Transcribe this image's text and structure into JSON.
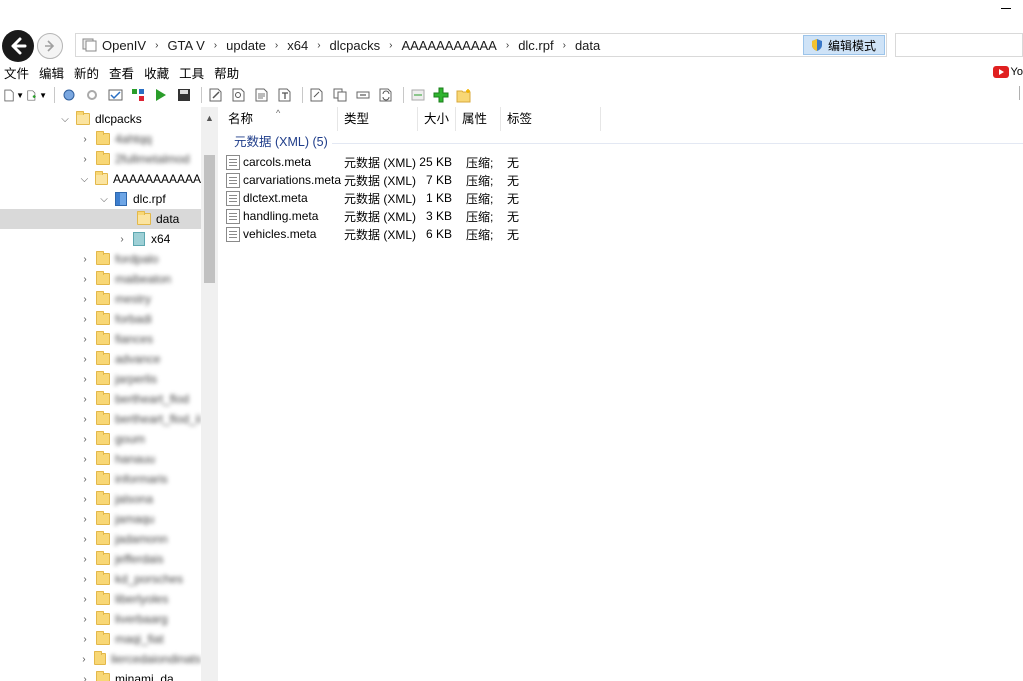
{
  "breadcrumb": [
    "OpenIV",
    "GTA V",
    "update",
    "x64",
    "dlcpacks",
    "AAAAAAAAAAA",
    "dlc.rpf",
    "data"
  ],
  "edit_mode_label": "编辑模式",
  "menu": [
    "文件",
    "编辑",
    "新的",
    "查看",
    "收藏",
    "工具",
    "帮助"
  ],
  "youtube_label": "Yo",
  "columns": {
    "name": "名称",
    "type": "类型",
    "size": "大小",
    "attr": "属性",
    "tag": "标签"
  },
  "group_header": "元数据 (XML) (5)",
  "files": [
    {
      "name": "carcols.meta",
      "type": "元数据 (XML)",
      "size": "25 KB",
      "attr": "压缩;",
      "tag": "无"
    },
    {
      "name": "carvariations.meta",
      "type": "元数据 (XML)",
      "size": "7 KB",
      "attr": "压缩;",
      "tag": "无"
    },
    {
      "name": "dlctext.meta",
      "type": "元数据 (XML)",
      "size": "1 KB",
      "attr": "压缩;",
      "tag": "无"
    },
    {
      "name": "handling.meta",
      "type": "元数据 (XML)",
      "size": "3 KB",
      "attr": "压缩;",
      "tag": "无"
    },
    {
      "name": "vehicles.meta",
      "type": "元数据 (XML)",
      "size": "6 KB",
      "attr": "压缩;",
      "tag": "无"
    }
  ],
  "tree": {
    "root": "dlcpacks",
    "blurred_1": "4ahtqq",
    "blurred_2": "2fullmetalmod",
    "selected_pack": "AAAAAAAAAAA",
    "rpf": "dlc.rpf",
    "data": "data",
    "x64": "x64",
    "blurred_rest": [
      "fordpalo",
      "maibeaton",
      "mestry",
      "forbadi",
      "fiances",
      "advance",
      "jarperlis",
      "bertheart_flod",
      "bertheart_flod_ii",
      "goum",
      "hanauu",
      "informaris",
      "jalsona",
      "jamaqu",
      "jadamonn",
      "jefferdais",
      "kd_porsches",
      "liberlyoles",
      "liverbaarg",
      "maqi_fiat",
      "liercedaiondinats"
    ],
    "last_item": "minami_da"
  }
}
